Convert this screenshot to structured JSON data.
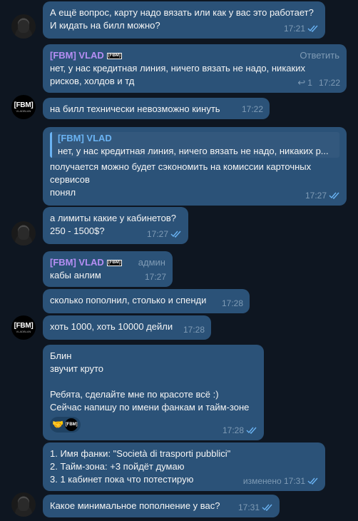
{
  "messages": [
    {
      "text": "А ещё вопрос, карту надо вязать или как у вас это работает?\nИ кидать на билл можно?",
      "time": "17:21"
    },
    {
      "sender": "[FBM] VLAD",
      "badge": "[FBM]",
      "role": "Ответить",
      "text": "нет, у нас кредитная линия, ничего вязать не надо, никаких рисков, холдов и тд",
      "replies": "1",
      "time": "17:22"
    },
    {
      "text": "на билл технически невозможно кинуть",
      "time": "17:22"
    },
    {
      "quote_name": "[FBM] VLAD",
      "quote_text": "нет, у нас кредитная линия, ничего вязать не надо, никаких р...",
      "text": "получается можно будет сэкономить на комиссии карточных сервисов\nпонял",
      "time": "17:27"
    },
    {
      "text": "а лимиты какие у кабинетов?\n250 - 1500$?",
      "time": "17:27"
    },
    {
      "sender": "[FBM] VLAD",
      "badge": "[FBM]",
      "role": "админ",
      "text": "кабы анлим",
      "time": "17:27"
    },
    {
      "text": "сколько пополнил, столько и спенди",
      "time": "17:28"
    },
    {
      "text": "хоть 1000, хоть 10000 дейли",
      "time": "17:28"
    },
    {
      "text": "Блин\nзвучит круто\n\nРебята, сделайте мне по красоте всё :)\nСейчас напишу по имени фанкам и тайм-зоне",
      "reaction_emoji": "🤝",
      "reaction_badge": "[FBM]",
      "time": "17:28"
    },
    {
      "text": "1. Имя фанки: \"Società di trasporti pubblici\"\n2. Тайм-зона: +3 пойдёт думаю\n3. 1 кабинет пока что потестирую",
      "time": "изменено 17:31"
    },
    {
      "text": "Какое минимальное пополнение у вас?",
      "time": "17:31"
    }
  ],
  "avatar_fbm": {
    "line1": "[FBM]",
    "line2": "VLADBLAN"
  },
  "colors": {
    "background": "#0e1621",
    "bubble": "#2b5278",
    "accent": "#6ab3f3",
    "sender": "#b68ef4"
  }
}
